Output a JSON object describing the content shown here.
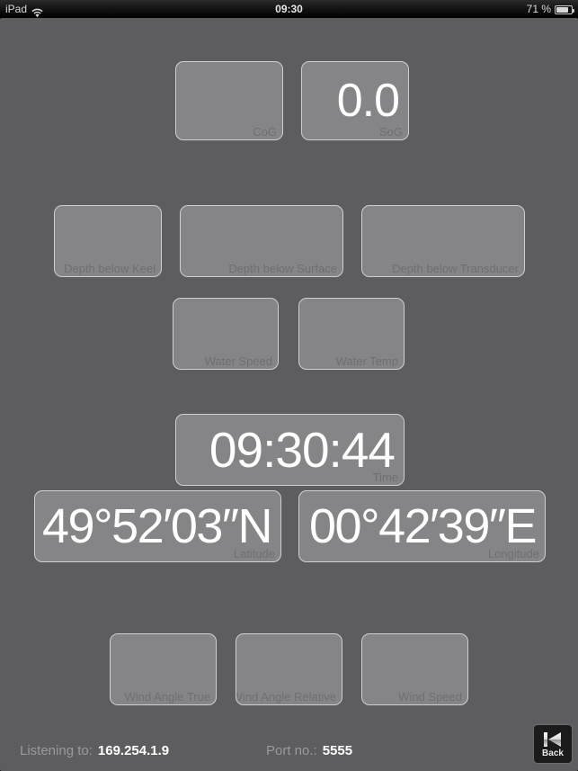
{
  "status_bar": {
    "carrier": "iPad",
    "wifi_icon": "wifi-icon",
    "time": "09:30",
    "battery_percent": "71 %",
    "battery_icon": "battery-icon"
  },
  "app": {
    "background_color": "#5d5d5f",
    "gauge_fill_color": "#858587",
    "gauge_border_color": "#cfcfd1",
    "label_color": "#6f6f72",
    "value_color": "#ffffff"
  },
  "gauges": [
    {
      "id": "cog",
      "label": "CoG",
      "value": ""
    },
    {
      "id": "sog",
      "label": "SoG",
      "value": "0.0"
    },
    {
      "id": "depth-below-keel",
      "label": "Depth below Keel",
      "value": ""
    },
    {
      "id": "depth-below-surface",
      "label": "Depth below Surface",
      "value": ""
    },
    {
      "id": "depth-below-transducer",
      "label": "Depth below Transducer",
      "value": ""
    },
    {
      "id": "water-speed",
      "label": "Water Speed",
      "value": ""
    },
    {
      "id": "water-temp",
      "label": "Water Temp",
      "value": ""
    },
    {
      "id": "time",
      "label": "Time",
      "value": "09:30:44"
    },
    {
      "id": "latitude",
      "label": "Latitude",
      "value": "49°52′03″N"
    },
    {
      "id": "longitude",
      "label": "Longitude",
      "value": "00°42′39″E"
    },
    {
      "id": "wind-angle-true",
      "label": "Wind Angle True",
      "value": ""
    },
    {
      "id": "wind-angle-relative",
      "label": "Wind Angle Relative",
      "value": ""
    },
    {
      "id": "wind-speed",
      "label": "Wind Speed",
      "value": ""
    }
  ],
  "bottom_bar": {
    "listening_label": "Listening to:",
    "listening_value": "169.254.1.9",
    "port_label": "Port no.:",
    "port_value": "5555",
    "back_button_label": "Back",
    "back_button_icon": "skip-back-icon"
  }
}
